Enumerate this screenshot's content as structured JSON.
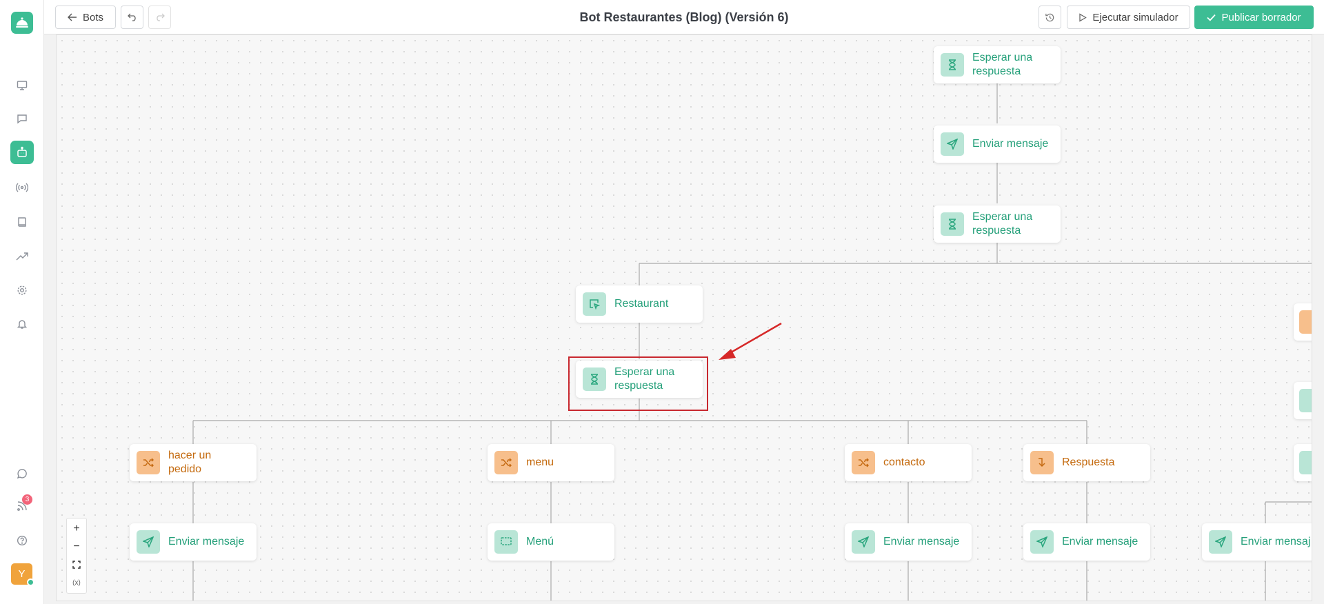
{
  "header": {
    "back_label": "Bots",
    "title": "Bot Restaurantes (Blog) (Versión 6)",
    "simulate_label": "Ejecutar simulador",
    "publish_label": "Publicar borrador"
  },
  "sidebar": {
    "notifications_badge": "3",
    "avatar_initial": "Y"
  },
  "nodes": {
    "top_wait_1": "Esperar una respuesta",
    "top_send": "Enviar mensaje",
    "top_wait_2": "Esperar una respuesta",
    "restaurant": "Restaurant",
    "wait_selected": "Esperar una respuesta",
    "hacer_pedido": "hacer un pedido",
    "menu": "menu",
    "contacto": "contacto",
    "respuesta": "Respuesta",
    "send_1": "Enviar mensaje",
    "menu_block": "Menú",
    "send_2": "Enviar mensaje",
    "send_3": "Enviar mensaje",
    "send_4": "Enviar mensaj"
  },
  "zoom": {
    "zoom_in": "+",
    "zoom_out": "−",
    "variables": "(x)"
  },
  "colors": {
    "accent": "#3dbd94",
    "node_green_text": "#25a07a",
    "node_orange_text": "#c46a0e",
    "annotation_red": "#d62828"
  }
}
